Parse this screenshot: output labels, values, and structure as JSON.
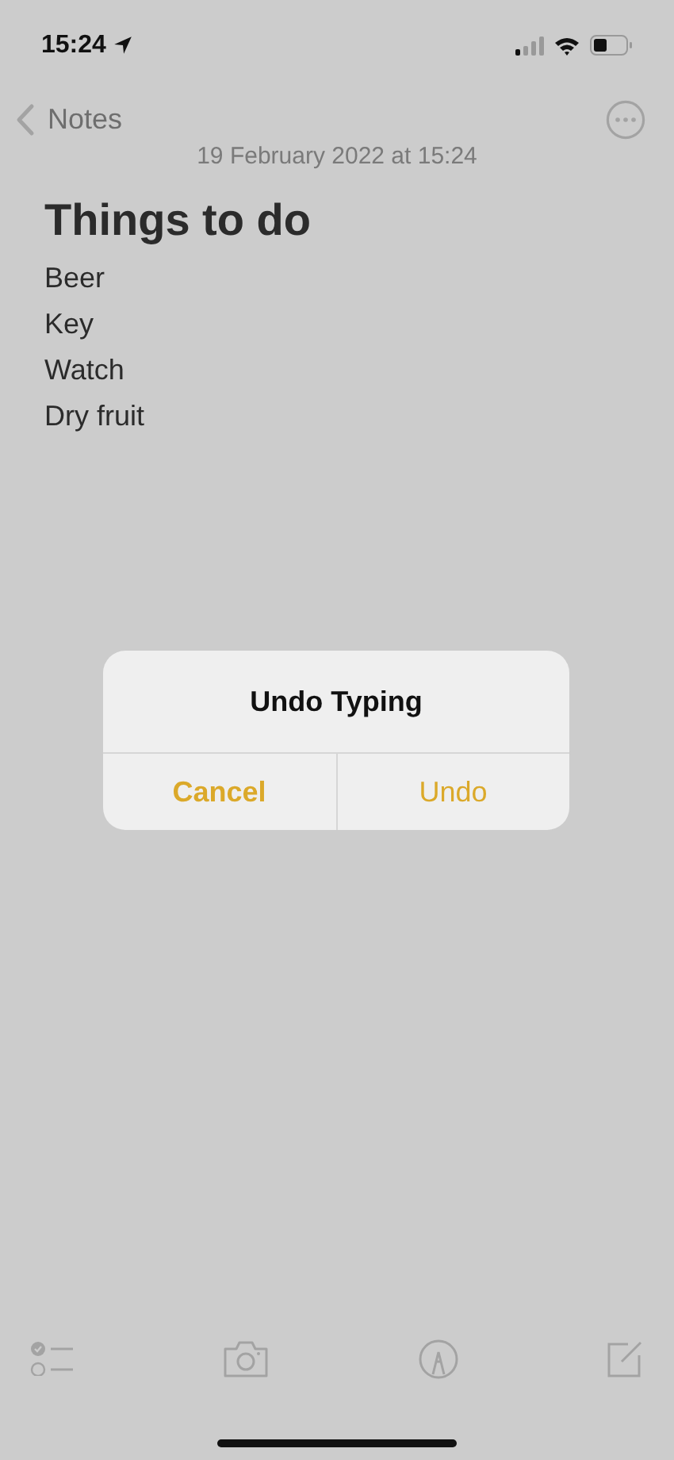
{
  "status_bar": {
    "time": "15:24"
  },
  "nav": {
    "back_label": "Notes",
    "date": "19 February 2022 at 15:24"
  },
  "note": {
    "title": "Things to do",
    "lines": [
      "Beer",
      "Key",
      "Watch",
      "Dry fruit"
    ]
  },
  "alert": {
    "title": "Undo Typing",
    "buttons": [
      {
        "label": "Cancel",
        "kind": "cancel"
      },
      {
        "label": "Undo",
        "kind": "default"
      }
    ]
  }
}
